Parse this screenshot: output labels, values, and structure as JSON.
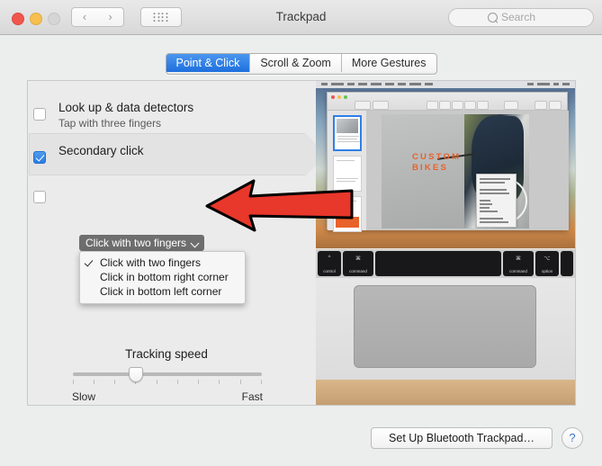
{
  "window": {
    "title": "Trackpad",
    "traffic_lights": [
      "close",
      "minimize",
      "zoom"
    ],
    "nav_back": "‹",
    "nav_forward": "›",
    "show_all_icon": "grid-icon"
  },
  "search": {
    "placeholder": "Search",
    "icon": "search-icon",
    "value": ""
  },
  "tabs": [
    {
      "label": "Point & Click",
      "active": true
    },
    {
      "label": "Scroll & Zoom",
      "active": false
    },
    {
      "label": "More Gestures",
      "active": false
    }
  ],
  "options": [
    {
      "title": "Look up & data detectors",
      "subtitle": "Tap with three fingers",
      "checked": false,
      "selected": false
    },
    {
      "title": "Secondary click",
      "subtitle": "",
      "checked": true,
      "selected": true,
      "popup_value": "Click with two fingers",
      "popup_icon": "chevron-down-icon"
    },
    {
      "title": "",
      "subtitle": "",
      "checked": false,
      "selected": false
    }
  ],
  "dropdown_menu": {
    "open": true,
    "items": [
      {
        "label": "Click with two fingers",
        "checked": true
      },
      {
        "label": "Click in bottom right corner",
        "checked": false
      },
      {
        "label": "Click in bottom left corner",
        "checked": false
      }
    ]
  },
  "tracking_speed": {
    "label": "Tracking speed",
    "min_label": "Slow",
    "max_label": "Fast",
    "value_percent": 31,
    "tick_count": 10
  },
  "preview": {
    "description": "trackpad-gesture-demo-video",
    "document_heading_line1": "CUSTOM",
    "document_heading_line2": "BIKES"
  },
  "footer": {
    "bluetooth_button": "Set Up Bluetooth Trackpad…",
    "help_button": "?"
  },
  "annotation": {
    "type": "arrow",
    "direction": "left",
    "fill": "#e8372b",
    "stroke": "#000000"
  },
  "colors": {
    "accent_blue": "#2f7fe8",
    "window_bg": "#eceded",
    "panel_bg": "#ebebeb",
    "popup_gray": "#6e6e6e"
  }
}
